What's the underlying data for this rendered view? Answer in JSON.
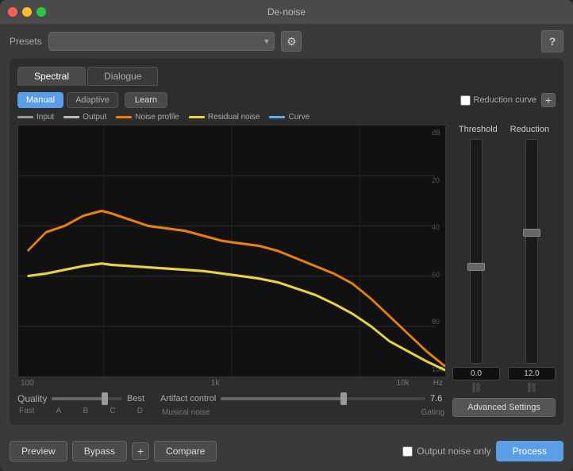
{
  "window": {
    "title": "De-noise"
  },
  "presets": {
    "label": "Presets",
    "placeholder": "",
    "gear_icon": "⚙",
    "help_icon": "?"
  },
  "tabs": [
    {
      "label": "Spectral",
      "active": true
    },
    {
      "label": "Dialogue",
      "active": false
    }
  ],
  "mode_buttons": [
    {
      "label": "Manual",
      "active": true
    },
    {
      "label": "Adaptive",
      "active": false
    }
  ],
  "learn_button": "Learn",
  "reduction_curve": {
    "label": "Reduction curve",
    "plus_label": "+"
  },
  "legend": [
    {
      "label": "Input",
      "color": "#999"
    },
    {
      "label": "Output",
      "color": "#bbb"
    },
    {
      "label": "Noise profile",
      "color": "#e8800a"
    },
    {
      "label": "Residual noise",
      "color": "#e8d440"
    },
    {
      "label": "Curve",
      "color": "#5ab0f0"
    }
  ],
  "chart": {
    "db_labels": [
      "dB",
      "20",
      "40",
      "60",
      "80",
      "100"
    ],
    "x_labels": [
      "100",
      "1k",
      "10k",
      "Hz"
    ]
  },
  "quality": {
    "label": "Quality",
    "fast_label": "Fast",
    "best_label": "Best",
    "sub_labels": [
      "A",
      "B",
      "C",
      "D"
    ],
    "value": 75
  },
  "artifact_control": {
    "label": "Artifact control",
    "value": "7.6",
    "musical_noise_label": "Musical noise",
    "gating_label": "Gating"
  },
  "threshold": {
    "label": "Threshold",
    "value": "0.0"
  },
  "reduction": {
    "label": "Reduction",
    "value": "12.0"
  },
  "advanced_settings": {
    "label": "Advanced Settings"
  },
  "bottom_bar": {
    "preview": "Preview",
    "bypass": "Bypass",
    "plus": "+",
    "compare": "Compare",
    "output_noise_only": "Output noise only",
    "process": "Process"
  }
}
